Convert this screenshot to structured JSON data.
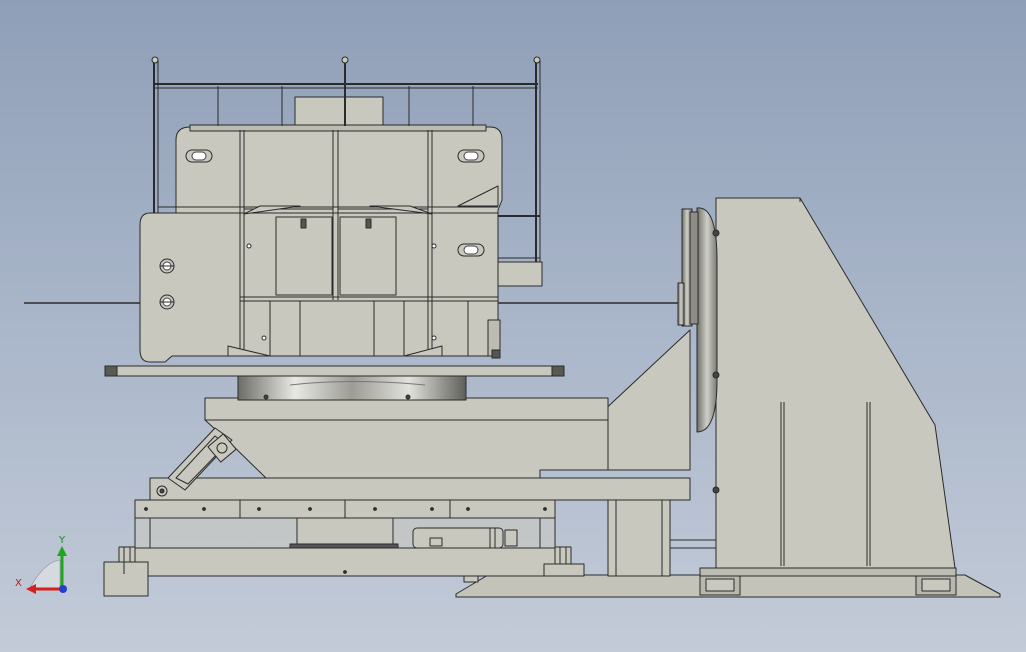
{
  "scene": {
    "background_top": "#8f9fb7",
    "background_bottom": "#c3cbd8",
    "part_fill": "#c9c8bf",
    "part_fill_dark": "#b9b8ae",
    "edge_color": "#2b2b2b",
    "description_icon": "cad-assembly-view"
  },
  "triad": {
    "x_label": "X",
    "y_label": "Y",
    "x_color": "#d42020",
    "y_color": "#1fa51f",
    "z_color": "#1e3fd0"
  }
}
